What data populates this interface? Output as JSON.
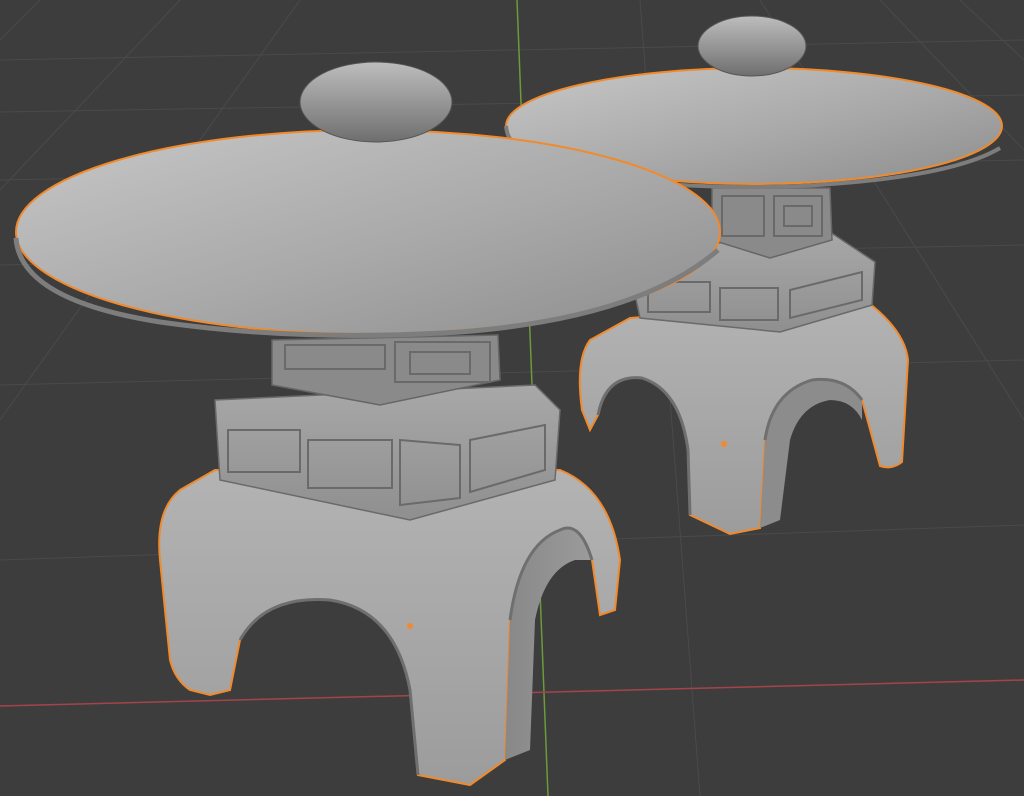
{
  "viewport": {
    "background_color": "#3d3d3d",
    "grid_line_color": "#4a4a4a",
    "x_axis_color": "#a5434b",
    "y_axis_color": "#6c9a3c",
    "selection_outline_color": "#f08a2c",
    "origin_dot_color": "#f08a2c"
  },
  "scene": {
    "objects": [
      {
        "name": "",
        "selected": true,
        "shading": "solid",
        "surface_color": "#a6a6a6"
      },
      {
        "name": "",
        "selected": true,
        "shading": "solid",
        "surface_color": "#a6a6a6"
      }
    ]
  }
}
